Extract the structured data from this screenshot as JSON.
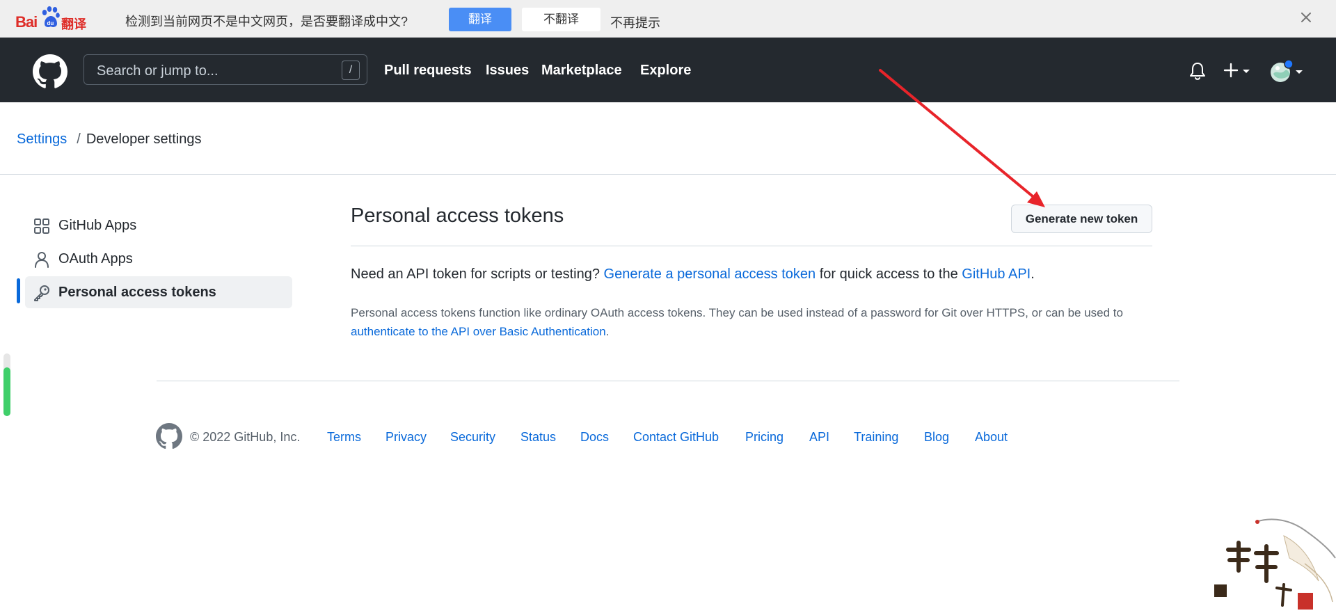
{
  "translate_bar": {
    "logo_text": "Bai",
    "logo_suffix": "翻译",
    "message": "检测到当前网页不是中文网页，是否要翻译成中文?",
    "translate_label": "翻译",
    "dont_translate_label": "不翻译",
    "never_label": "不再提示",
    "accent_color": "#4a8ef5"
  },
  "header": {
    "search_placeholder": "Search or jump to...",
    "search_shortcut": "/",
    "nav": [
      {
        "label": "Pull requests"
      },
      {
        "label": "Issues"
      },
      {
        "label": "Marketplace"
      },
      {
        "label": "Explore"
      }
    ],
    "icons": [
      "github-mark-icon",
      "bell-icon",
      "plus-icon",
      "avatar"
    ]
  },
  "breadcrumb": {
    "parent": "Settings",
    "separator": "/",
    "current": "Developer settings"
  },
  "sidebar": {
    "items": [
      {
        "label": "GitHub Apps",
        "icon": "apps-grid-icon",
        "active": false
      },
      {
        "label": "OAuth Apps",
        "icon": "person-icon",
        "active": false
      },
      {
        "label": "Personal access tokens",
        "icon": "key-icon",
        "active": true
      }
    ]
  },
  "main": {
    "title": "Personal access tokens",
    "generate_button": "Generate new token",
    "lead_prefix": "Need an API token for scripts or testing?",
    "lead_link": "Generate a personal access token",
    "lead_middle": "for quick access to the",
    "lead_api_link": "GitHub API",
    "lead_suffix": ".",
    "note_text": "Personal access tokens function like ordinary OAuth access tokens. They can be used instead of a password for Git over HTTPS, or can be used to",
    "note_link": "authenticate to the API over Basic Authentication",
    "note_suffix": "."
  },
  "footer": {
    "copyright": "© 2022 GitHub, Inc.",
    "links": [
      "Terms",
      "Privacy",
      "Security",
      "Status",
      "Docs",
      "Contact GitHub",
      "Pricing",
      "API",
      "Training",
      "Blog",
      "About"
    ]
  },
  "colors": {
    "header_bg": "#24292f",
    "link": "#0969da",
    "active_indicator": "#0969da",
    "annotation_arrow": "#e8242a"
  }
}
